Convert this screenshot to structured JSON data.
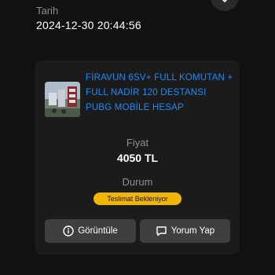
{
  "colors": {
    "background": "#111111",
    "card": "#1b1b1c",
    "accent_link": "#1d8cf2",
    "status_badge": "#f2b705",
    "button": "#3f3f42"
  },
  "header": {
    "date_label": "Tarih",
    "date_value": "2024-12-30 20:44:56",
    "top_action_icon": "chevron-down-icon"
  },
  "order": {
    "product_icon": "product-thumbnail",
    "product_title": "FİRAVUN 6SV+ FULL KOMUTAN + FULL NADİR 120 DESTANSI PUBG MOBİLE HESAP",
    "price_label": "Fiyat",
    "price_value": "4050 TL",
    "status_label": "Durum",
    "status_badge": "Teslimat Bekleniyor"
  },
  "actions": {
    "view_label": "Görüntüle",
    "view_icon": "info-icon",
    "review_label": "Yorum Yap",
    "review_icon": "comment-icon"
  }
}
